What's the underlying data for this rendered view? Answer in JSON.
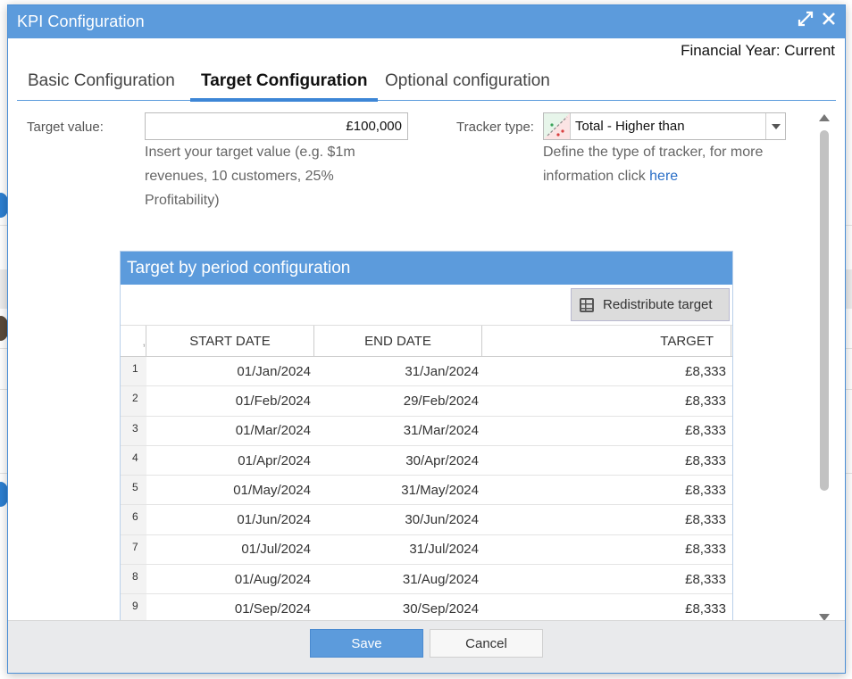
{
  "dialog": {
    "title": "KPI Configuration",
    "financial_year": "Financial Year: Current"
  },
  "tabs": [
    {
      "label": "Basic Configuration",
      "active": false
    },
    {
      "label": "Target Configuration",
      "active": true
    },
    {
      "label": "Optional configuration",
      "active": false
    }
  ],
  "form": {
    "target_label": "Target value:",
    "target_value": "£100,000",
    "target_help": "Insert your target value (e.g. $1m revenues, 10 customers, 25% Profitability)",
    "tracker_label": "Tracker type:",
    "tracker_value": "Total - Higher than",
    "tracker_help_prefix": "Define the type of tracker, for more information click ",
    "tracker_help_link": "here"
  },
  "panel": {
    "title": "Target by period configuration",
    "redistribute_label": "Redistribute target",
    "columns": [
      "START DATE",
      "END DATE",
      "TARGET"
    ],
    "rows": [
      {
        "idx": "1",
        "start": "01/Jan/2024",
        "end": "31/Jan/2024",
        "target": "£8,333"
      },
      {
        "idx": "2",
        "start": "01/Feb/2024",
        "end": "29/Feb/2024",
        "target": "£8,333"
      },
      {
        "idx": "3",
        "start": "01/Mar/2024",
        "end": "31/Mar/2024",
        "target": "£8,333"
      },
      {
        "idx": "4",
        "start": "01/Apr/2024",
        "end": "30/Apr/2024",
        "target": "£8,333"
      },
      {
        "idx": "5",
        "start": "01/May/2024",
        "end": "31/May/2024",
        "target": "£8,333"
      },
      {
        "idx": "6",
        "start": "01/Jun/2024",
        "end": "30/Jun/2024",
        "target": "£8,333"
      },
      {
        "idx": "7",
        "start": "01/Jul/2024",
        "end": "31/Jul/2024",
        "target": "£8,333"
      },
      {
        "idx": "8",
        "start": "01/Aug/2024",
        "end": "31/Aug/2024",
        "target": "£8,333"
      },
      {
        "idx": "9",
        "start": "01/Sep/2024",
        "end": "30/Sep/2024",
        "target": "£8,333"
      }
    ]
  },
  "footer": {
    "save_label": "Save",
    "cancel_label": "Cancel"
  },
  "colors": {
    "accent": "#5c9bdc",
    "link": "#2a6fc7"
  },
  "icons": [
    "expand-icon",
    "close-icon",
    "tracker-type-icon",
    "dropdown-arrow-icon",
    "grid-icon",
    "scroll-up-icon",
    "scroll-down-icon"
  ]
}
